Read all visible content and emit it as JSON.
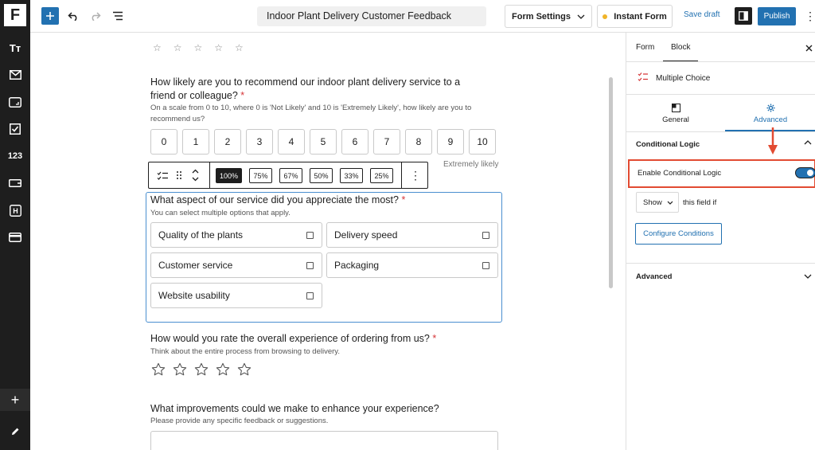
{
  "app": {
    "logo": "F"
  },
  "sidebar": {
    "items": [
      {
        "icon": "typography-icon",
        "label": "Tт"
      },
      {
        "icon": "mail-icon"
      },
      {
        "icon": "card-icon"
      },
      {
        "icon": "checkbox-icon"
      },
      {
        "icon": "number-icon",
        "label": "123"
      },
      {
        "icon": "input-icon"
      },
      {
        "icon": "heading-icon",
        "label": "H"
      },
      {
        "icon": "payment-icon"
      }
    ]
  },
  "toolbar": {
    "document_title": "Indoor Plant Delivery Customer Feedback",
    "form_settings_label": "Form Settings",
    "instant_form_label": "Instant Form",
    "save_draft_label": "Save draft",
    "publish_label": "Publish"
  },
  "canvas": {
    "nps_question": {
      "title": "How likely are you to recommend our indoor plant delivery service to a friend or colleague?",
      "required_mark": "*",
      "description": "On a scale from 0 to 10, where 0 is 'Not Likely' and 10 is 'Extremely Likely', how likely are you to recommend us?",
      "scale": [
        "0",
        "1",
        "2",
        "3",
        "4",
        "5",
        "6",
        "7",
        "8",
        "9",
        "10"
      ],
      "high_label": "Extremely likely"
    },
    "block_toolbar": {
      "widths": [
        "100%",
        "75%",
        "67%",
        "50%",
        "33%",
        "25%"
      ],
      "active_width": "100%"
    },
    "multiple_choice": {
      "title": "What aspect of our service did you appreciate the most?",
      "required_mark": "*",
      "description": "You can select multiple options that apply.",
      "options": [
        "Quality of the plants",
        "Delivery speed",
        "Customer service",
        "Packaging",
        "Website usability"
      ]
    },
    "rating_question": {
      "title": "How would you rate the overall experience of ordering from us?",
      "required_mark": "*",
      "description": "Think about the entire process from browsing to delivery.",
      "star_count": 5
    },
    "improvement_question": {
      "title": "What improvements could we make to enhance your experience?",
      "description": "Please provide any specific feedback or suggestions."
    }
  },
  "right_panel": {
    "tabs": [
      "Form",
      "Block"
    ],
    "active_tab": "Block",
    "block_name": "Multiple Choice",
    "subtabs": [
      "General",
      "Advanced"
    ],
    "active_subtab": "Advanced",
    "conditional_logic": {
      "section_title": "Conditional Logic",
      "enable_label": "Enable Conditional Logic",
      "enabled": true,
      "show_value": "Show",
      "suffix_text": "this field if",
      "configure_label": "Configure Conditions"
    },
    "advanced_section_title": "Advanced"
  },
  "colors": {
    "accent": "#2271b1",
    "highlight": "#e24b32",
    "required": "#d63638"
  }
}
